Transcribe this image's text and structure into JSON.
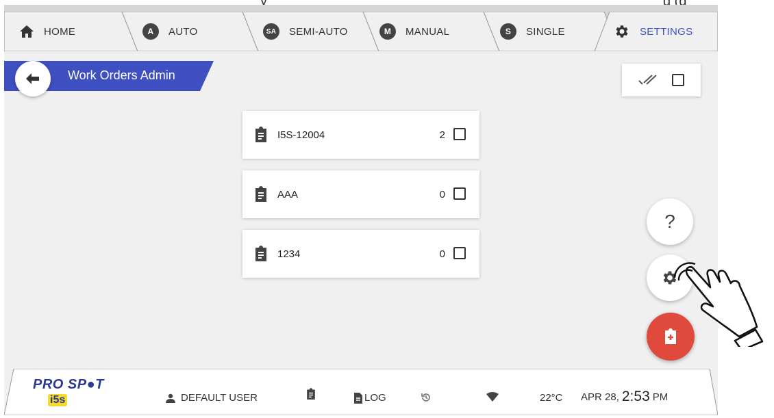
{
  "top_fragment": {
    "left": "y",
    "right": "g   (g"
  },
  "tabs": [
    {
      "id": "home",
      "label": "HOME",
      "icon": "home-icon",
      "badge": ""
    },
    {
      "id": "auto",
      "label": "AUTO",
      "icon": "auto-badge-icon",
      "badge": "A"
    },
    {
      "id": "semi-auto",
      "label": "SEMI-AUTO",
      "icon": "semi-auto-badge-icon",
      "badge": "SA"
    },
    {
      "id": "manual",
      "label": "MANUAL",
      "icon": "manual-badge-icon",
      "badge": "M"
    },
    {
      "id": "single",
      "label": "SINGLE",
      "icon": "single-badge-icon",
      "badge": "S"
    },
    {
      "id": "settings",
      "label": "SETTINGS",
      "icon": "gear-icon",
      "badge": "",
      "active": true
    }
  ],
  "page": {
    "title": "Work Orders Admin"
  },
  "work_orders": [
    {
      "name": "I5S-12004",
      "count": "2"
    },
    {
      "name": "AAA",
      "count": "0"
    },
    {
      "name": "1234",
      "count": "0"
    }
  ],
  "fabs": {
    "help_label": "?"
  },
  "status": {
    "logo_text": "PRO SP●T",
    "logo_sub": "i5s",
    "user": "DEFAULT USER",
    "log": "LOG",
    "temperature": "22°C",
    "date": "APR 28,",
    "time": "2:53",
    "ampm": "PM"
  },
  "colors": {
    "accent": "#3b4fc4",
    "banner": "#3e4fc0",
    "fab_add": "#e04a3c",
    "background": "#f0f0f0",
    "tabbar": "#d6d6d6"
  }
}
